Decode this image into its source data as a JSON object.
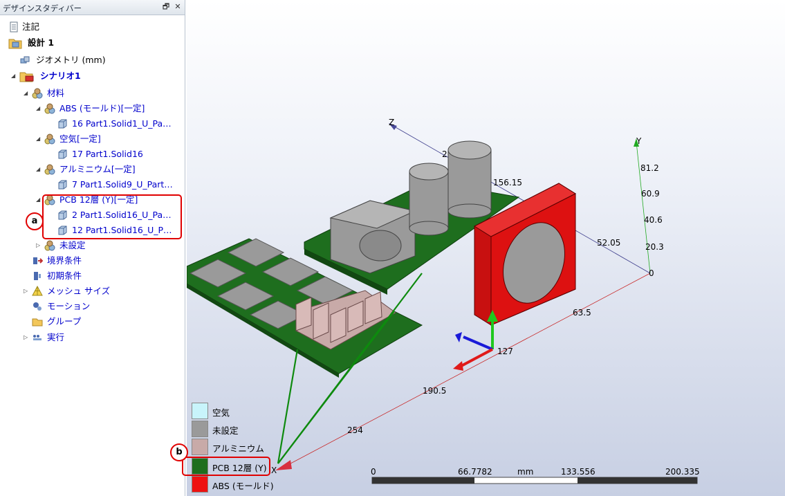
{
  "panel": {
    "title": "デザインスタディバー",
    "pin": "🗗",
    "close": "✕",
    "tree": {
      "notes": "注記",
      "design": "設計 1",
      "geometry": "ジオメトリ (mm)",
      "scenario": "シナリオ1",
      "materials": "材料",
      "abs": "ABS (モールド)[一定]",
      "abs_part": "16 Part1.Solid1_U_Pa…",
      "air": "空気[一定]",
      "air_part": "17 Part1.Solid16",
      "aluminum": "アルミニウム[一定]",
      "aluminum_part": "7 Part1.Solid9_U_Part…",
      "pcb": "PCB 12層 (Y)[一定]",
      "pcb_part1": "2 Part1.Solid16_U_Pa…",
      "pcb_part2": "12 Part1.Solid16_U_P…",
      "unset": "未設定",
      "boundary": "境界条件",
      "initial": "初期条件",
      "mesh": "メッシュ サイズ",
      "motion": "モーション",
      "group": "グループ",
      "run": "実行"
    }
  },
  "callouts": {
    "a": "a",
    "b": "b"
  },
  "legend": [
    {
      "label": "空気",
      "color": "#c8f4fb"
    },
    {
      "label": "未設定",
      "color": "#9a9a9a"
    },
    {
      "label": "アルミニウム",
      "color": "#c8aaa8"
    },
    {
      "label": "PCB 12層 (Y)",
      "color": "#1e6e1e"
    },
    {
      "label": "ABS (モールド)",
      "color": "#ee1111"
    }
  ],
  "axes": {
    "z_label": "Z",
    "y_label": "Y",
    "x_label": "X",
    "z_ticks": [
      "2",
      "156.15",
      "52.05"
    ],
    "y_ticks": [
      "81.2",
      "60.9",
      "40.6",
      "20.3",
      "0"
    ],
    "x_ticks": [
      "63.5",
      "127",
      "190.5",
      "254"
    ]
  },
  "scale_bar": {
    "ticks": [
      "0",
      "66.7782",
      "133.556",
      "200.335"
    ],
    "unit": "mm"
  },
  "colors": {
    "pcb_green": "#1e6e1e",
    "abs_red": "#dd1111",
    "gray": "#9a9a9a",
    "aluminum": "#c8aaa8",
    "highlight": "#e00000"
  }
}
